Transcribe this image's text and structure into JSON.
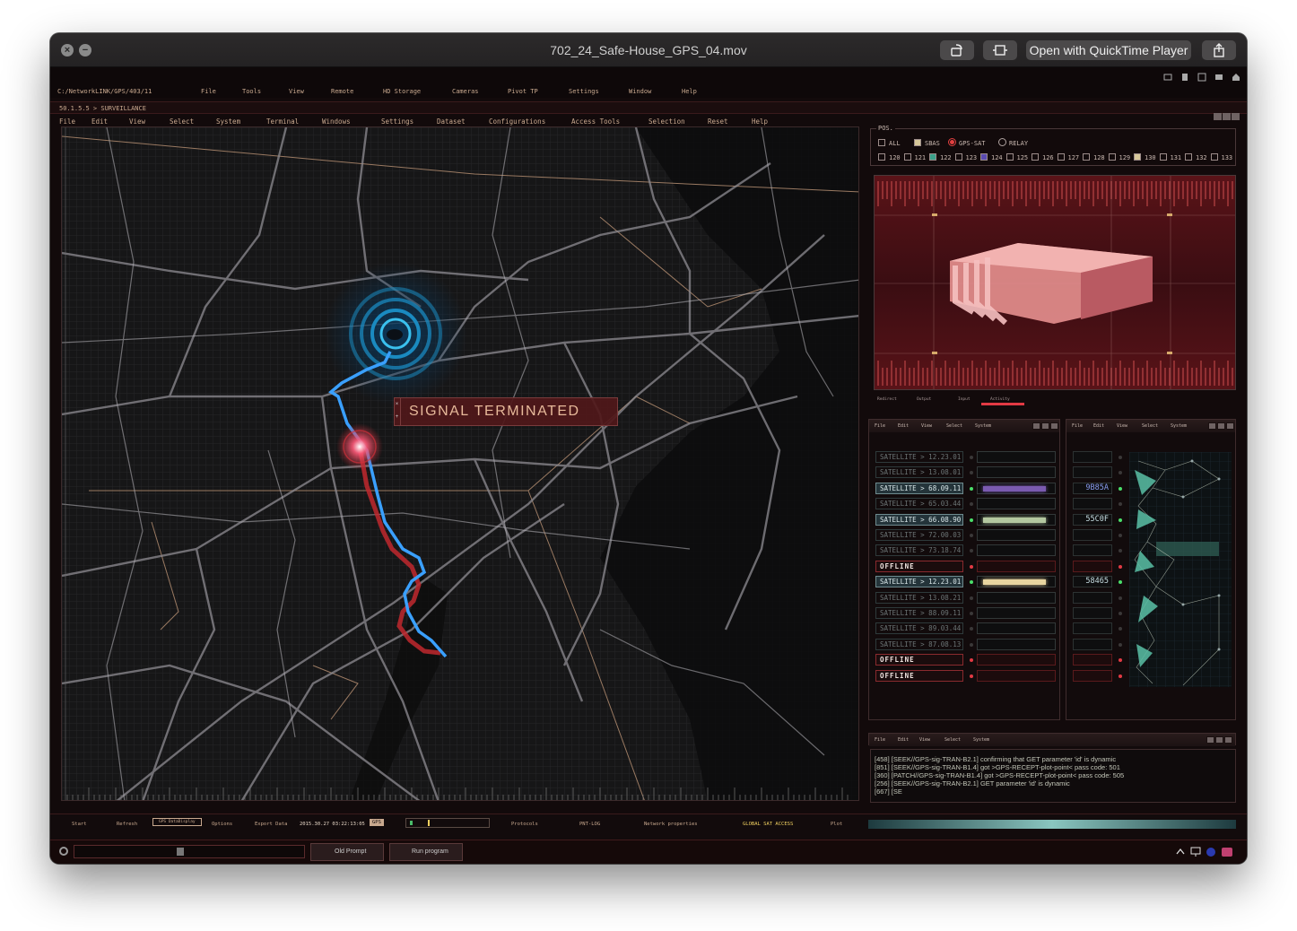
{
  "window": {
    "title": "702_24_Safe-House_GPS_04.mov",
    "open_button": "Open with QuickTime Player"
  },
  "topbar": {
    "path": "C:/NetworkLINK/GPS/403/11",
    "menu": [
      "File",
      "Tools",
      "View",
      "Remote",
      "HD Storage",
      "Cameras",
      "Pivot TP",
      "Settings",
      "Window",
      "Help"
    ]
  },
  "breadcrumb": "50.1.5.5 > SURVEILLANCE",
  "menu2": [
    "File",
    "Edit",
    "View",
    "Select",
    "System",
    "Terminal",
    "Windows",
    "Settings",
    "Dataset",
    "Configurations",
    "Access Tools",
    "Selection",
    "Reset",
    "Help"
  ],
  "map": {
    "alert": "SIGNAL TERMINATED"
  },
  "pos": {
    "label": "POS.",
    "options": [
      "ALL",
      "SBAS",
      "GPS-SAT",
      "RELAY"
    ],
    "selected": "GPS-SAT",
    "channels": [
      "120",
      "121",
      "122",
      "123",
      "124",
      "125",
      "126",
      "127",
      "128",
      "129",
      "130",
      "131",
      "132",
      "133"
    ]
  },
  "viz": {
    "footer": [
      "Redirect",
      "Output",
      "Input",
      "Activity"
    ]
  },
  "satellite_panel": {
    "menu": [
      "File",
      "Edit",
      "View",
      "Select",
      "System"
    ],
    "rows": [
      {
        "label": "SATELLITE  >  12.23.01",
        "state": "dim"
      },
      {
        "label": "SATELLITE  >  13.08.01",
        "state": "dim"
      },
      {
        "label": "SATELLITE  >  68.09.11",
        "state": "hl",
        "bar": "#7a5ab0"
      },
      {
        "label": "SATELLITE  >  65.03.44",
        "state": "dim"
      },
      {
        "label": "SATELLITE  >  66.08.90",
        "state": "hl",
        "bar": "#b4c7a0"
      },
      {
        "label": "SATELLITE  >  72.00.03",
        "state": "dim"
      },
      {
        "label": "SATELLITE  >  73.18.74",
        "state": "dim"
      },
      {
        "label": "OFFLINE",
        "state": "off"
      },
      {
        "label": "SATELLITE  >  12.23.01",
        "state": "hl",
        "bar": "#e8d5a0"
      },
      {
        "label": "SATELLITE  >  13.08.21",
        "state": "dim"
      },
      {
        "label": "SATELLITE  >  88.09.11",
        "state": "dim"
      },
      {
        "label": "SATELLITE  >  89.03.44",
        "state": "dim"
      },
      {
        "label": "SATELLITE  >  87.08.13",
        "state": "dim"
      },
      {
        "label": "OFFLINE",
        "state": "off"
      },
      {
        "label": "OFFLINE",
        "state": "off"
      }
    ]
  },
  "hex_panel": {
    "menu": [
      "File",
      "Edit",
      "View",
      "Select",
      "System"
    ],
    "values": [
      "",
      "",
      "9B85A",
      "",
      "55C0F",
      "",
      "",
      "",
      "58465",
      "",
      "",
      "",
      "",
      "",
      ""
    ]
  },
  "log_panel": {
    "menu": [
      "File",
      "Edit",
      "View",
      "Select",
      "System"
    ],
    "lines": [
      "[458]  [SEEK//GPS-sig-TRAN-B2.1]  confirming that GET parameter 'id' is dynamic",
      "[851]  [SEEK//GPS-sig-TRAN-B1.4]  got >GPS-RECEPT-plot-point< pass code: 501",
      "[360]  [PATCH//GPS-sig-TRAN-B1.4]  got >GPS-RECEPT-plot-point< pass code: 505",
      "[256]  [SEEK//GPS-sig-TRAN-B2.1] GET parameter 'id' is dynamic",
      "[667]  [SE"
    ]
  },
  "bottom": {
    "buttons": [
      "Start",
      "Refresh",
      "GPS DataDisplay",
      "Options",
      "Export Data"
    ],
    "timestamp": "2015.30.27  03:22:13:05",
    "gps": "GPS",
    "tabs": [
      "Protocols",
      "PNT-LOG",
      "Network properties"
    ],
    "global": "GLOBAL  SAT  ACCESS",
    "plot": "Plot"
  },
  "taskbar": {
    "items": [
      "Old Prompt",
      "Run program"
    ]
  },
  "colors": {
    "accent": "#c9a98f",
    "route_blue": "#3aa0ff",
    "route_red": "#c0282e",
    "alert_bg": "#50181a"
  }
}
